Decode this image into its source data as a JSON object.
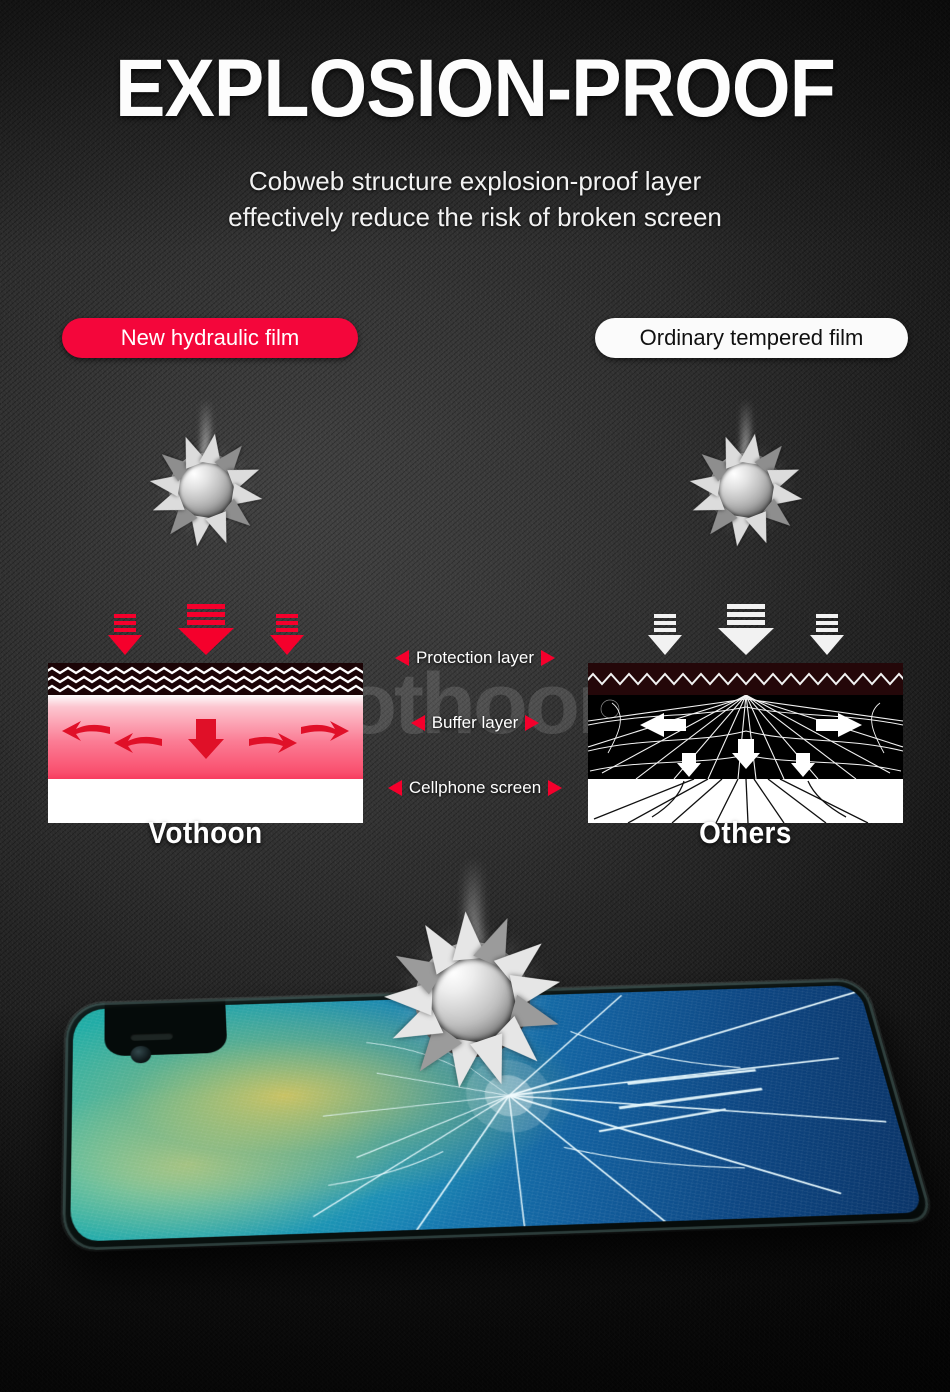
{
  "header": {
    "title": "EXPLOSION-PROOF",
    "subtitle": "Cobweb structure  explosion-proof layer\neffectively reduce the risk of broken screen"
  },
  "badges": {
    "left": "New hydraulic film",
    "right": "Ordinary tempered film"
  },
  "comparison": {
    "left": {
      "brand": "Vothoon"
    },
    "right": {
      "brand": "Others"
    },
    "layer_labels": [
      "Protection layer",
      "Buffer layer",
      "Cellphone screen"
    ]
  },
  "watermark": {
    "text": "Vothoon",
    "mark": "®"
  },
  "icons": {
    "impact_ball": "spiked-ball-icon",
    "down_arrow": "down-arrow-icon",
    "left_arrow": "left-arrow-icon",
    "right_arrow": "right-arrow-icon",
    "triangle_left": "triangle-left-icon",
    "triangle_right": "triangle-right-icon"
  },
  "colors": {
    "accent_red": "#f5002c",
    "badge_red": "#f4063b",
    "badge_white": "#fbfbfb",
    "buffer_pink": "#fb7d95",
    "background_dark": "#161616",
    "screen_white": "#ffffff",
    "phone_teal": "#1ea99f",
    "phone_blue": "#0a3468"
  }
}
